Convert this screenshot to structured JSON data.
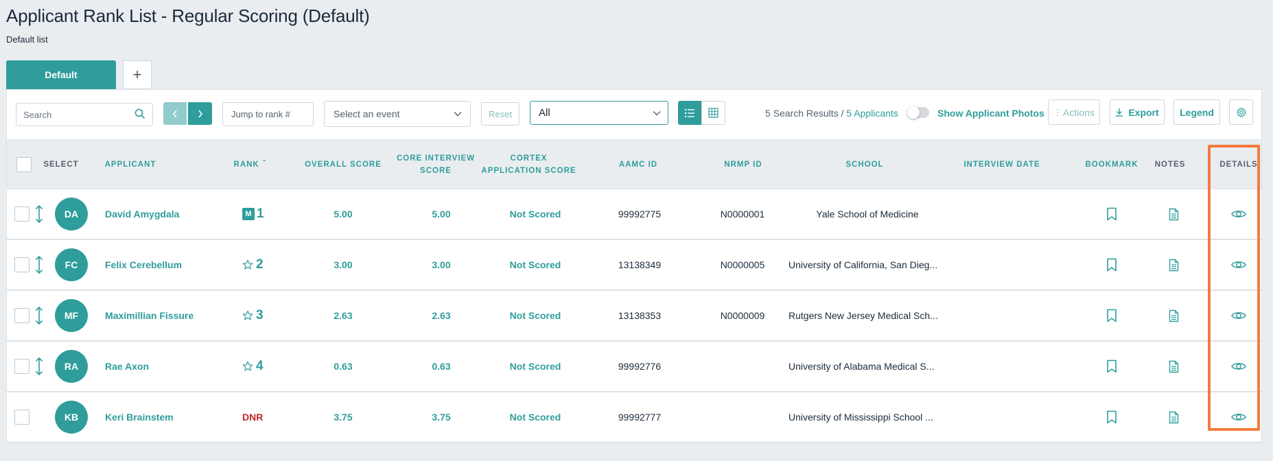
{
  "page": {
    "title": "Applicant Rank List - Regular Scoring (Default)",
    "subtitle": "Default list"
  },
  "tabs": {
    "default_label": "Default",
    "add_label": "+"
  },
  "toolbar": {
    "search_placeholder": "Search",
    "jump_placeholder": "Jump to rank #",
    "event_select": "Select an event",
    "reset_label": "Reset",
    "filter_select": "All",
    "results_count": "5 Search Results",
    "results_sep": " / ",
    "applicants_count": "5 Applicants",
    "show_photos_label": "Show Applicant Photos",
    "actions_label": "Actions",
    "export_label": "Export",
    "legend_label": "Legend"
  },
  "columns": {
    "select": "SELECT",
    "applicant": "APPLICANT",
    "rank": "RANK",
    "overall_score": "OVERALL SCORE",
    "core_interview_score": "CORE INTERVIEW SCORE",
    "cortex_application_score": "CORTEX APPLICATION SCORE",
    "aamc_id": "AAMC ID",
    "nrmp_id": "NRMP ID",
    "school": "SCHOOL",
    "interview_date": "INTERVIEW DATE",
    "bookmark": "BOOKMARK",
    "notes": "NOTES",
    "details": "DETAILS"
  },
  "rows": [
    {
      "initials": "DA",
      "name": "David Amygdala",
      "badge": "M",
      "rank": "1",
      "overall": "5.00",
      "core": "5.00",
      "cortex": "Not Scored",
      "aamc": "99992775",
      "nrmp": "N0000001",
      "school": "Yale School of Medicine",
      "interview_date": ""
    },
    {
      "initials": "FC",
      "name": "Felix Cerebellum",
      "badge": "",
      "rank": "2",
      "overall": "3.00",
      "core": "3.00",
      "cortex": "Not Scored",
      "aamc": "13138349",
      "nrmp": "N0000005",
      "school": "University of California, San Dieg...",
      "interview_date": ""
    },
    {
      "initials": "MF",
      "name": "Maximillian Fissure",
      "badge": "",
      "rank": "3",
      "overall": "2.63",
      "core": "2.63",
      "cortex": "Not Scored",
      "aamc": "13138353",
      "nrmp": "N0000009",
      "school": "Rutgers New Jersey Medical Sch...",
      "interview_date": ""
    },
    {
      "initials": "RA",
      "name": "Rae Axon",
      "badge": "",
      "rank": "4",
      "overall": "0.63",
      "core": "0.63",
      "cortex": "Not Scored",
      "aamc": "99992776",
      "nrmp": "",
      "school": "University of Alabama Medical S...",
      "interview_date": ""
    },
    {
      "initials": "KB",
      "name": "Keri Brainstem",
      "badge": "",
      "rank": "DNR",
      "overall": "3.75",
      "core": "3.75",
      "cortex": "Not Scored",
      "aamc": "99992777",
      "nrmp": "",
      "school": "University of Mississippi School ...",
      "interview_date": ""
    }
  ],
  "colors": {
    "accent": "#2e9d9b",
    "accent_light": "#8fcccb",
    "dnr": "#c0262b",
    "highlight": "#f47a3c",
    "background": "#eaedf0"
  }
}
